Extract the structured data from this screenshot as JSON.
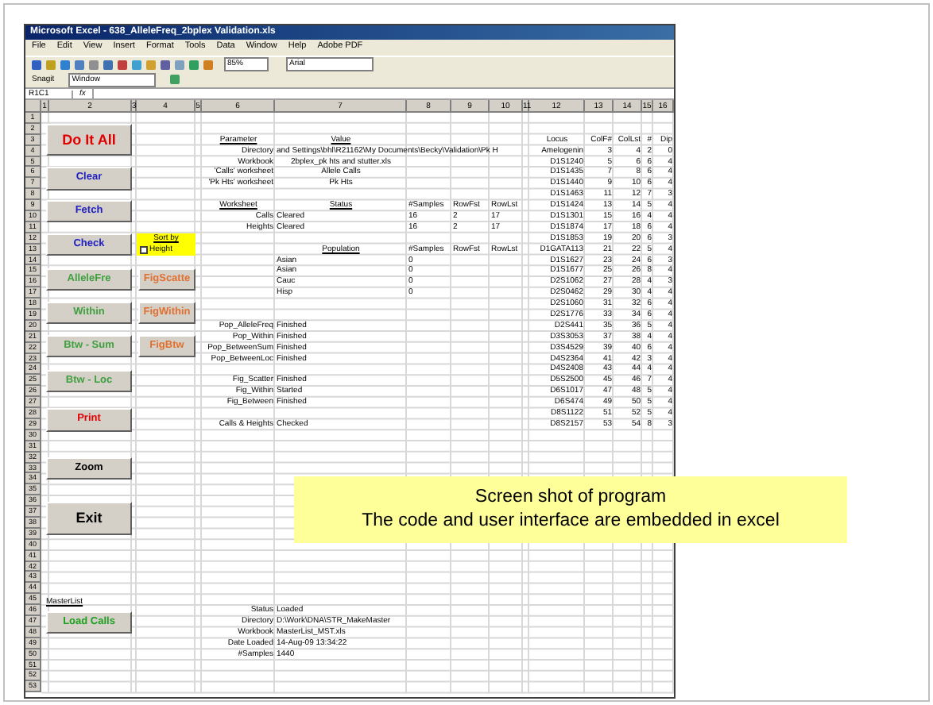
{
  "window": {
    "title": "Microsoft Excel - 638_AlleleFreq_2bplex Validation.xls"
  },
  "menu": [
    "File",
    "Edit",
    "View",
    "Insert",
    "Format",
    "Tools",
    "Data",
    "Window",
    "Help",
    "Adobe PDF"
  ],
  "toolbar": {
    "zoom": "85%",
    "font": "Arial"
  },
  "toolbar_2": {
    "snagit": "Snagit",
    "window": "Window"
  },
  "formula_bar": {
    "cell": "R1C1",
    "fx": "fx"
  },
  "column_headers": [
    "1",
    "2",
    "3",
    "4",
    "5",
    "6",
    "7",
    "8",
    "9",
    "10",
    "11",
    "12",
    "13",
    "14",
    "15",
    "16"
  ],
  "row_headers": [
    "1",
    "2",
    "3",
    "4",
    "5",
    "6",
    "7",
    "8",
    "9",
    "10",
    "11",
    "12",
    "13",
    "14",
    "15",
    "16",
    "17",
    "18",
    "19",
    "20",
    "21",
    "22",
    "23",
    "24",
    "25",
    "26",
    "27",
    "28",
    "29",
    "30",
    "31",
    "32",
    "33",
    "34",
    "35",
    "36",
    "37",
    "38",
    "39",
    "40",
    "41",
    "42",
    "43",
    "44",
    "45",
    "46",
    "47",
    "48",
    "49",
    "50",
    "51",
    "52",
    "53"
  ],
  "buttons": [
    {
      "label": "Do It All",
      "color": "#e00000",
      "kind": "large"
    },
    {
      "label": "Clear",
      "color": "#2020c0",
      "kind": "normal"
    },
    {
      "label": "Fetch",
      "color": "#2020c0",
      "kind": "normal"
    },
    {
      "label": "Check",
      "color": "#2020c0",
      "kind": "normal"
    },
    {
      "label": "AlleleFre",
      "color": "#40a040",
      "kind": "normal"
    },
    {
      "label": "Within",
      "color": "#40a040",
      "kind": "normal"
    },
    {
      "label": "Btw - Sum",
      "color": "#40a040",
      "kind": "normal"
    },
    {
      "label": "Btw - Loc",
      "color": "#40a040",
      "kind": "normal"
    },
    {
      "label": "Print",
      "color": "#e00000",
      "kind": "normal"
    },
    {
      "label": "Zoom",
      "color": "#000000",
      "kind": "normal"
    },
    {
      "label": "Exit",
      "color": "#000000",
      "kind": "large"
    }
  ],
  "fig_buttons": [
    {
      "label": "FigScatte",
      "color": "#e07030"
    },
    {
      "label": "FigWithin",
      "color": "#e07030"
    },
    {
      "label": "FigBtw",
      "color": "#e07030"
    }
  ],
  "sort_box": {
    "title": "Sort by",
    "option": "Height",
    "checked": false
  },
  "parameters": {
    "headers": [
      "Parameter",
      "Value"
    ],
    "rows": [
      {
        "label": "Directory",
        "value": "and Settings\\bhl\\R21162\\My Documents\\Becky\\Validation\\Pk H"
      },
      {
        "label": "Workbook",
        "value": "2bplex_pk hts and stutter.xls"
      },
      {
        "label": "'Calls' worksheet",
        "value": "Allele Calls"
      },
      {
        "label": "'Pk Hts' worksheet",
        "value": "Pk Hts"
      }
    ]
  },
  "worksheets": {
    "headers": [
      "Worksheet",
      "Status",
      "#Samples",
      "RowFst",
      "RowLst"
    ],
    "rows": [
      {
        "name": "Calls",
        "status": "Cleared",
        "samples": "16",
        "first": "2",
        "last": "17"
      },
      {
        "name": "Heights",
        "status": "Cleared",
        "samples": "16",
        "first": "2",
        "last": "17"
      }
    ]
  },
  "populations": {
    "headers": [
      "Population",
      "#Samples",
      "RowFst",
      "RowLst"
    ],
    "rows": [
      {
        "name": "Asian",
        "samples": "0"
      },
      {
        "name": "Asian",
        "samples": "0"
      },
      {
        "name": "Cauc",
        "samples": "0"
      },
      {
        "name": "Hisp",
        "samples": "0"
      }
    ]
  },
  "task_groups": [
    [
      {
        "name": "Pop_AlleleFreq",
        "status": "Finished"
      },
      {
        "name": "Pop_Within",
        "status": "Finished"
      },
      {
        "name": "Pop_BetweenSum",
        "status": "Finished"
      },
      {
        "name": "Pop_BetweenLoc",
        "status": "Finished"
      }
    ],
    [
      {
        "name": "Fig_Scatter",
        "status": "Finished"
      },
      {
        "name": "Fig_Within",
        "status": "Started"
      },
      {
        "name": "Fig_Between",
        "status": "Finished"
      }
    ],
    [
      {
        "name": "Calls & Heights",
        "status": "Checked"
      }
    ]
  ],
  "master_list": {
    "link": "MasterList",
    "button": {
      "label": "Load Calls",
      "color": "#20a020"
    },
    "rows": [
      {
        "label": "Status",
        "value": "Loaded"
      },
      {
        "label": "Directory",
        "value": "D:\\Work\\DNA\\STR_MakeMaster"
      },
      {
        "label": "Workbook",
        "value": "MasterList_MST.xls"
      },
      {
        "label": "Date Loaded",
        "value": "14-Aug-09 13:34:22"
      },
      {
        "label": "#Samples",
        "value": "1440"
      }
    ]
  },
  "loci": {
    "columns": [
      "Locus",
      "ColF#",
      "ColLst",
      "#",
      "Dip"
    ],
    "rows": [
      [
        "Amelogenin",
        "3",
        "4",
        "2",
        "0"
      ],
      [
        "D1S1240",
        "5",
        "6",
        "6",
        "4"
      ],
      [
        "D1S1435",
        "7",
        "8",
        "6",
        "4"
      ],
      [
        "D1S1440",
        "9",
        "10",
        "6",
        "4"
      ],
      [
        "D1S1463",
        "11",
        "12",
        "7",
        "3"
      ],
      [
        "D1S1424",
        "13",
        "14",
        "5",
        "4"
      ],
      [
        "D1S1301",
        "15",
        "16",
        "4",
        "4"
      ],
      [
        "D1S1874",
        "17",
        "18",
        "6",
        "4"
      ],
      [
        "D1S1853",
        "19",
        "20",
        "6",
        "3"
      ],
      [
        "D1GATA113",
        "21",
        "22",
        "5",
        "4"
      ],
      [
        "D1S1627",
        "23",
        "24",
        "6",
        "3"
      ],
      [
        "D1S1677",
        "25",
        "26",
        "8",
        "4"
      ],
      [
        "D2S1062",
        "27",
        "28",
        "4",
        "3"
      ],
      [
        "D2S0462",
        "29",
        "30",
        "4",
        "4"
      ],
      [
        "D2S1060",
        "31",
        "32",
        "6",
        "4"
      ],
      [
        "D2S1776",
        "33",
        "34",
        "6",
        "4"
      ],
      [
        "D2S441",
        "35",
        "36",
        "5",
        "4"
      ],
      [
        "D3S3053",
        "37",
        "38",
        "4",
        "4"
      ],
      [
        "D3S4529",
        "39",
        "40",
        "6",
        "4"
      ],
      [
        "D4S2364",
        "41",
        "42",
        "3",
        "4"
      ],
      [
        "D4S2408",
        "43",
        "44",
        "4",
        "4"
      ],
      [
        "D5S2500",
        "45",
        "46",
        "7",
        "4"
      ],
      [
        "D6S1017",
        "47",
        "48",
        "5",
        "4"
      ],
      [
        "D6S474",
        "49",
        "50",
        "5",
        "4"
      ],
      [
        "D8S1122",
        "51",
        "52",
        "5",
        "4"
      ],
      [
        "D8S2157",
        "53",
        "54",
        "8",
        "3"
      ]
    ]
  },
  "callout": [
    "Screen shot of program",
    "The code and user interface are embedded in excel"
  ]
}
